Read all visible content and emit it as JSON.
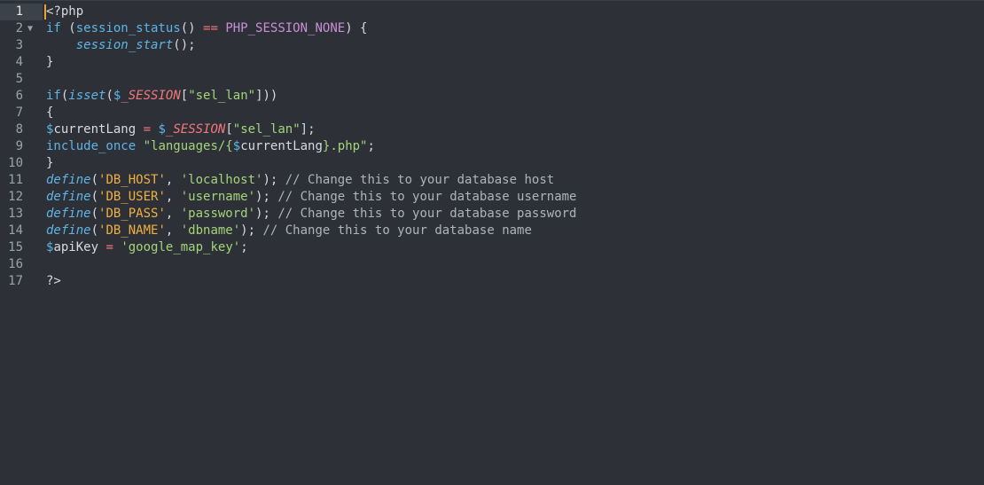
{
  "editor": {
    "language": "php",
    "active_line": 1,
    "foldable_lines": [
      2
    ],
    "lines": [
      {
        "n": "1",
        "tokens": [
          {
            "t": "<?php",
            "c": "plain"
          }
        ]
      },
      {
        "n": "2",
        "tokens": [
          {
            "t": "if",
            "c": "kw"
          },
          {
            "t": " (",
            "c": "punc"
          },
          {
            "t": "session_status",
            "c": "kw"
          },
          {
            "t": "() ",
            "c": "punc"
          },
          {
            "t": "==",
            "c": "op"
          },
          {
            "t": " ",
            "c": "plain"
          },
          {
            "t": "PHP_SESSION_NONE",
            "c": "const"
          },
          {
            "t": ") {",
            "c": "punc"
          }
        ]
      },
      {
        "n": "3",
        "tokens": [
          {
            "t": "    ",
            "c": "plain"
          },
          {
            "t": "session_start",
            "c": "fn"
          },
          {
            "t": "();",
            "c": "punc"
          }
        ]
      },
      {
        "n": "4",
        "tokens": [
          {
            "t": "}",
            "c": "punc"
          }
        ]
      },
      {
        "n": "5",
        "tokens": []
      },
      {
        "n": "6",
        "tokens": [
          {
            "t": "if",
            "c": "kw"
          },
          {
            "t": "(",
            "c": "punc"
          },
          {
            "t": "isset",
            "c": "fn"
          },
          {
            "t": "(",
            "c": "punc"
          },
          {
            "t": "$",
            "c": "dollar"
          },
          {
            "t": "_SESSION",
            "c": "var"
          },
          {
            "t": "[",
            "c": "punc"
          },
          {
            "t": "\"sel_lan\"",
            "c": "str"
          },
          {
            "t": "]))",
            "c": "punc"
          }
        ]
      },
      {
        "n": "7",
        "tokens": [
          {
            "t": "{",
            "c": "punc"
          }
        ]
      },
      {
        "n": "8",
        "tokens": [
          {
            "t": "$",
            "c": "dollar"
          },
          {
            "t": "currentLang",
            "c": "plain"
          },
          {
            "t": " ",
            "c": "plain"
          },
          {
            "t": "=",
            "c": "op"
          },
          {
            "t": " ",
            "c": "plain"
          },
          {
            "t": "$",
            "c": "dollar"
          },
          {
            "t": "_SESSION",
            "c": "var"
          },
          {
            "t": "[",
            "c": "punc"
          },
          {
            "t": "\"sel_lan\"",
            "c": "str"
          },
          {
            "t": "];",
            "c": "punc"
          }
        ]
      },
      {
        "n": "9",
        "tokens": [
          {
            "t": "include_once",
            "c": "kw"
          },
          {
            "t": " ",
            "c": "plain"
          },
          {
            "t": "\"languages/{",
            "c": "str"
          },
          {
            "t": "$",
            "c": "dollar"
          },
          {
            "t": "currentLang",
            "c": "plain"
          },
          {
            "t": "}.php\"",
            "c": "str"
          },
          {
            "t": ";",
            "c": "punc"
          }
        ]
      },
      {
        "n": "10",
        "tokens": [
          {
            "t": "}",
            "c": "punc"
          }
        ]
      },
      {
        "n": "11",
        "tokens": [
          {
            "t": "define",
            "c": "fn"
          },
          {
            "t": "(",
            "c": "punc"
          },
          {
            "t": "'DB_HOST'",
            "c": "strk"
          },
          {
            "t": ", ",
            "c": "punc"
          },
          {
            "t": "'localhost'",
            "c": "str"
          },
          {
            "t": "); ",
            "c": "punc"
          },
          {
            "t": "// Change this to your database host",
            "c": "cmt"
          }
        ]
      },
      {
        "n": "12",
        "tokens": [
          {
            "t": "define",
            "c": "fn"
          },
          {
            "t": "(",
            "c": "punc"
          },
          {
            "t": "'DB_USER'",
            "c": "strk"
          },
          {
            "t": ", ",
            "c": "punc"
          },
          {
            "t": "'username'",
            "c": "str"
          },
          {
            "t": "); ",
            "c": "punc"
          },
          {
            "t": "// Change this to your database username",
            "c": "cmt"
          }
        ]
      },
      {
        "n": "13",
        "tokens": [
          {
            "t": "define",
            "c": "fn"
          },
          {
            "t": "(",
            "c": "punc"
          },
          {
            "t": "'DB_PASS'",
            "c": "strk"
          },
          {
            "t": ", ",
            "c": "punc"
          },
          {
            "t": "'password'",
            "c": "str"
          },
          {
            "t": "); ",
            "c": "punc"
          },
          {
            "t": "// Change this to your database password",
            "c": "cmt"
          }
        ]
      },
      {
        "n": "14",
        "tokens": [
          {
            "t": "define",
            "c": "fn"
          },
          {
            "t": "(",
            "c": "punc"
          },
          {
            "t": "'DB_NAME'",
            "c": "strk"
          },
          {
            "t": ", ",
            "c": "punc"
          },
          {
            "t": "'dbname'",
            "c": "str"
          },
          {
            "t": "); ",
            "c": "punc"
          },
          {
            "t": "// Change this to your database name",
            "c": "cmt"
          }
        ]
      },
      {
        "n": "15",
        "tokens": [
          {
            "t": "$",
            "c": "dollar"
          },
          {
            "t": "apiKey",
            "c": "plain"
          },
          {
            "t": " ",
            "c": "plain"
          },
          {
            "t": "=",
            "c": "op"
          },
          {
            "t": " ",
            "c": "plain"
          },
          {
            "t": "'google_map_key'",
            "c": "str"
          },
          {
            "t": ";",
            "c": "punc"
          }
        ]
      },
      {
        "n": "16",
        "tokens": []
      },
      {
        "n": "17",
        "tokens": [
          {
            "t": "?>",
            "c": "plain"
          }
        ]
      }
    ]
  },
  "colors": {
    "background": "#2d3137",
    "active_line": "#3c424a",
    "cursor": "#f0a030",
    "keyword": "#5fb4e6",
    "operator": "#f2777a",
    "constant": "#c98fd6",
    "string": "#a3d47a",
    "define_key": "#f0b040",
    "comment": "#aeb4bc"
  },
  "icons": {
    "fold": "fold-arrow-down-icon"
  }
}
